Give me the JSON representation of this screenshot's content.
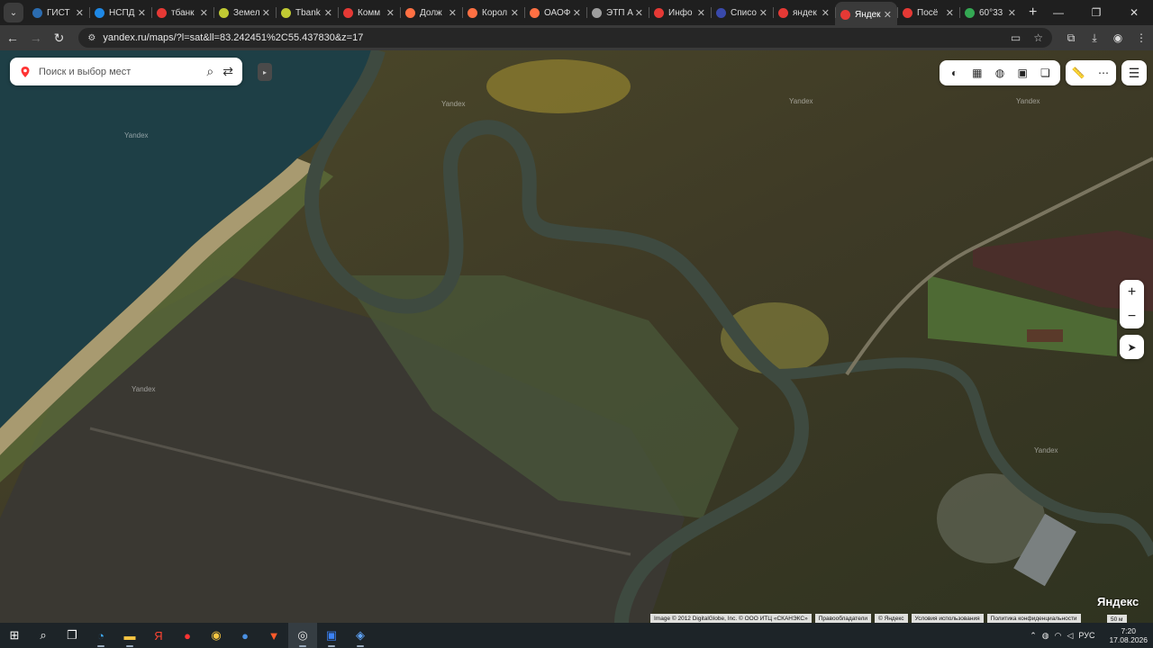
{
  "browser": {
    "tabs": [
      {
        "label": "ГИСТ",
        "favicon": "gist-icon",
        "color": "#2b6cb0"
      },
      {
        "label": "НСПД",
        "favicon": "nspd-icon",
        "color": "#1e88e5"
      },
      {
        "label": "тбанк",
        "favicon": "yandex-icon",
        "color": "#e53935"
      },
      {
        "label": "Земел",
        "favicon": "land-icon",
        "color": "#c0ca33"
      },
      {
        "label": "Tbank",
        "favicon": "land-icon",
        "color": "#c0ca33"
      },
      {
        "label": "Комм",
        "favicon": "triangle-icon",
        "color": "#e53935"
      },
      {
        "label": "Долж",
        "favicon": "cube-icon",
        "color": "#ff7043"
      },
      {
        "label": "Корол",
        "favicon": "cube-icon",
        "color": "#ff7043"
      },
      {
        "label": "ОАОФ",
        "favicon": "cube-icon",
        "color": "#ff7043"
      },
      {
        "label": "ЭТП А",
        "favicon": "globe-icon",
        "color": "#9e9e9e"
      },
      {
        "label": "Инфо",
        "favicon": "triangle-icon",
        "color": "#e53935"
      },
      {
        "label": "Списо",
        "favicon": "flag-icon",
        "color": "#3949ab"
      },
      {
        "label": "яндек",
        "favicon": "yandex-icon",
        "color": "#e53935"
      },
      {
        "label": "Яндек",
        "favicon": "map-pin-icon",
        "color": "#e53935"
      },
      {
        "label": "Посё",
        "favicon": "map-pin-icon",
        "color": "#e53935"
      },
      {
        "label": "60°33",
        "favicon": "google-maps-icon",
        "color": "#34a853"
      }
    ],
    "active_tab": 13,
    "url": "yandex.ru/maps/?l=sat&ll=83.242451%2C55.437830&z=17"
  },
  "map": {
    "search_placeholder": "Поиск и выбор мест",
    "layer_controls": [
      "layers-icon",
      "panorama-icon",
      "traffic-icon",
      "transit-icon",
      "stack-icon"
    ],
    "tool_controls": [
      "ruler-icon",
      "more-icon"
    ],
    "zoom_in": "+",
    "zoom_out": "−",
    "logo": "Яндекс",
    "watermark": "Yandex",
    "credits": {
      "imagery": "Image © 2012 DigitalGlobe, Inc. © ООО ИТЦ «СКАНЭКС»",
      "rights": "Правообладатели",
      "yandex": "© Яндекс",
      "terms": "Условия использования",
      "privacy": "Политика конфиденциальности"
    },
    "scale_label": "50 м",
    "colors": {
      "accent": "#ff3333",
      "water": "#1e3f46"
    }
  },
  "taskbar": {
    "icons": [
      "windows-start-icon",
      "search-icon",
      "task-view-icon",
      "edge-icon",
      "explorer-icon",
      "yandex-icon",
      "yandex-browser-icon",
      "beeline-icon",
      "globe-icon",
      "brave-icon",
      "chrome-icon",
      "app-icon",
      "app2-icon"
    ],
    "language": "РУС",
    "time": "7:20",
    "date": "17.08.2026"
  }
}
